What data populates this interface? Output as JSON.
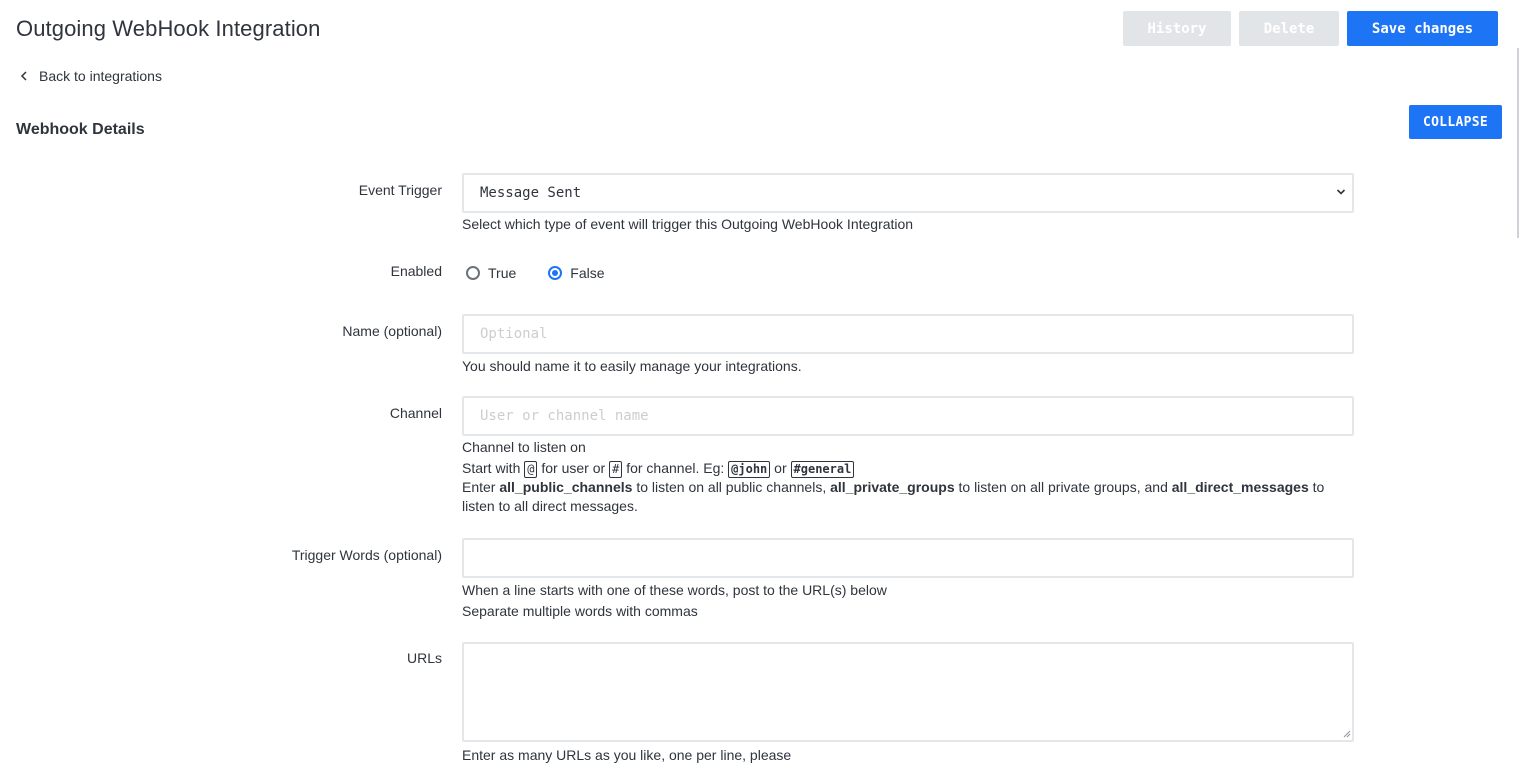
{
  "header": {
    "title": "Outgoing WebHook Integration",
    "history_label": "History",
    "delete_label": "Delete",
    "save_label": "Save changes"
  },
  "back_link": "Back to integrations",
  "section": {
    "title": "Webhook Details",
    "collapse_label": "COLLAPSE"
  },
  "form": {
    "event_trigger": {
      "label": "Event Trigger",
      "value": "Message Sent",
      "help": "Select which type of event will trigger this Outgoing WebHook Integration"
    },
    "enabled": {
      "label": "Enabled",
      "options": [
        "True",
        "False"
      ],
      "selected": "False"
    },
    "name": {
      "label": "Name (optional)",
      "value": "",
      "placeholder": "Optional",
      "help": "You should name it to easily manage your integrations."
    },
    "channel": {
      "label": "Channel",
      "value": "",
      "placeholder": "User or channel name",
      "help_line1": "Channel to listen on",
      "help_line2": {
        "start": "Start with",
        "at": "@",
        "for_user": "for user or",
        "hash": "#",
        "for_channel": "for channel. Eg:",
        "eg_user": "@john",
        "or": "or",
        "eg_channel": "#general"
      },
      "help_line3": {
        "enter": "Enter",
        "public": "all_public_channels",
        "listen_public": "to listen on all public channels,",
        "private": "all_private_groups",
        "listen_private": "to listen on all private groups, and",
        "direct": "all_direct_messages",
        "listen_direct": "to listen to all direct messages."
      }
    },
    "trigger_words": {
      "label": "Trigger Words (optional)",
      "value": "",
      "help_line1": "When a line starts with one of these words, post to the URL(s) below",
      "help_line2": "Separate multiple words with commas"
    },
    "urls": {
      "label": "URLs",
      "value": "",
      "help": "Enter as many URLs as you like, one per line, please"
    }
  },
  "colors": {
    "primary": "#1d74f5",
    "disabled_button": "#e1e5e8",
    "text": "#2f343d",
    "border": "#e4e7ea"
  }
}
